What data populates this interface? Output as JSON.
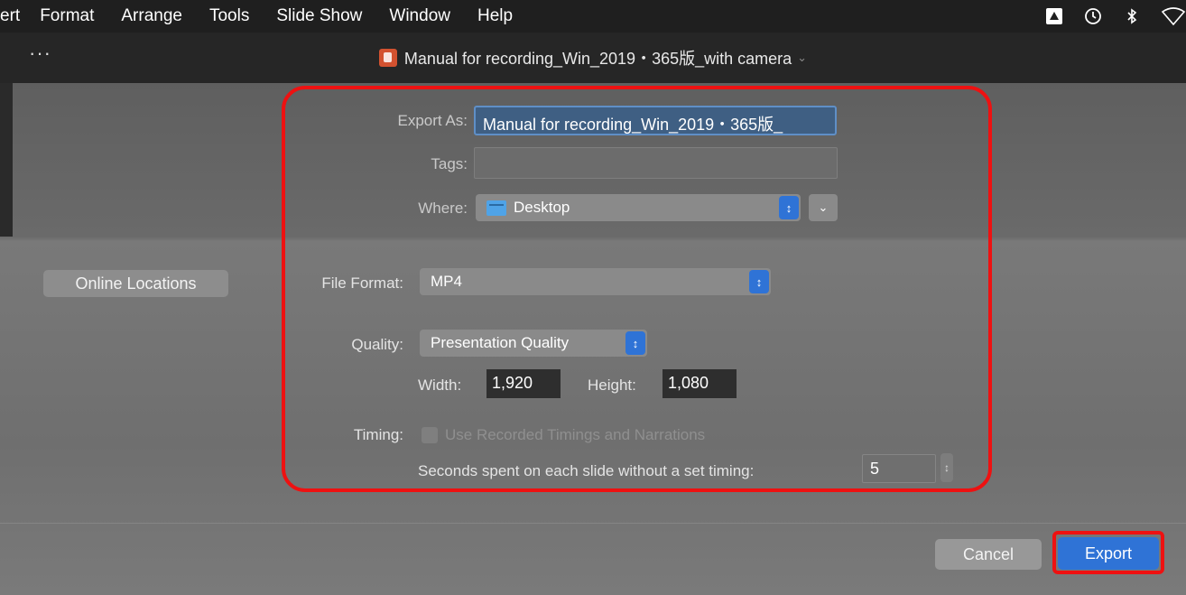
{
  "menubar": {
    "items": [
      "ert",
      "Format",
      "Arrange",
      "Tools",
      "Slide Show",
      "Window",
      "Help"
    ]
  },
  "titlebar": {
    "dots": "···",
    "doc_title": "Manual for recording_Win_2019・365版_with camera"
  },
  "dialog": {
    "export_as_label": "Export As:",
    "export_as_value": "Manual for recording_Win_2019・365版_",
    "tags_label": "Tags:",
    "tags_value": "",
    "where_label": "Where:",
    "where_value": "Desktop",
    "online_locations_label": "Online Locations",
    "file_format_label": "File Format:",
    "file_format_value": "MP4",
    "quality_label": "Quality:",
    "quality_value": "Presentation Quality",
    "width_label": "Width:",
    "width_value": "1,920",
    "height_label": "Height:",
    "height_value": "1,080",
    "timing_label": "Timing:",
    "timing_checkbox_label": "Use Recorded Timings and Narrations",
    "seconds_label": "Seconds spent on each slide without a set timing:",
    "seconds_value": "5",
    "cancel_label": "Cancel",
    "export_label": "Export"
  },
  "colors": {
    "accent": "#2f73d6",
    "highlight_border": "#ee1111"
  }
}
